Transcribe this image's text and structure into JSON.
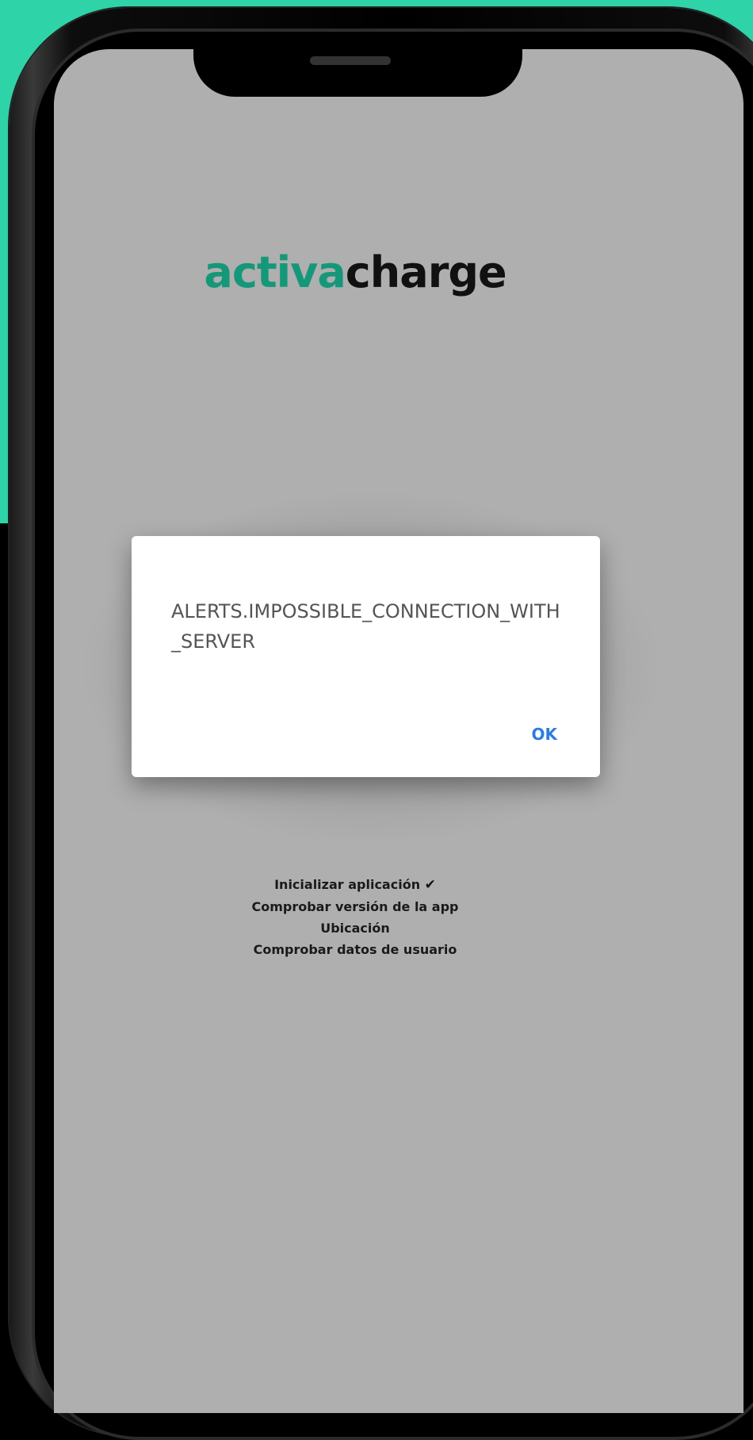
{
  "colors": {
    "accent_teal": "#2fd3a8",
    "logo_green": "#15987a",
    "screen_gray": "#afafaf",
    "ok_blue": "#2e7be2"
  },
  "logo": {
    "part_a": "activa",
    "part_b": "charge"
  },
  "dialog": {
    "message": "ALERTS.IMPOSSIBLE_CONNECTION_WITH_SERVER",
    "ok_label": "OK"
  },
  "startup_steps": [
    {
      "label": "Inicializar aplicación",
      "done_icon": "checkmark-icon",
      "done_glyph": "✔"
    },
    {
      "label": "Comprobar versión de la app"
    },
    {
      "label": "Ubicación"
    },
    {
      "label": "Comprobar datos de usuario"
    }
  ]
}
